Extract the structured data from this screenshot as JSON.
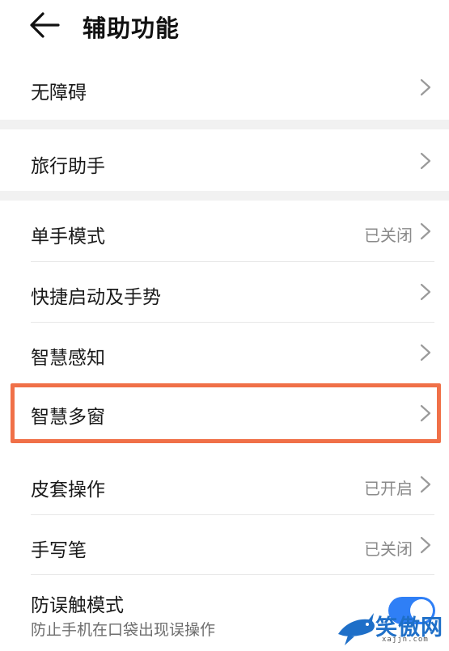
{
  "header": {
    "title": "辅助功能"
  },
  "groups": [
    {
      "items": [
        {
          "label": "无障碍"
        }
      ]
    },
    {
      "items": [
        {
          "label": "旅行助手"
        }
      ]
    },
    {
      "items": [
        {
          "label": "单手模式",
          "status": "已关闭"
        },
        {
          "label": "快捷启动及手势"
        },
        {
          "label": "智慧感知"
        },
        {
          "label": "智慧多窗"
        },
        {
          "label": "皮套操作",
          "status": "已开启"
        },
        {
          "label": "手写笔",
          "status": "已关闭"
        },
        {
          "label": "防误触模式",
          "description": "防止手机在口袋出现误操作",
          "toggle_on": true
        }
      ]
    }
  ],
  "highlight_color": "#f07048",
  "accent_color": "#2f7ff6",
  "watermark": {
    "text": "笑傲网",
    "domain": "xajjn.com"
  }
}
